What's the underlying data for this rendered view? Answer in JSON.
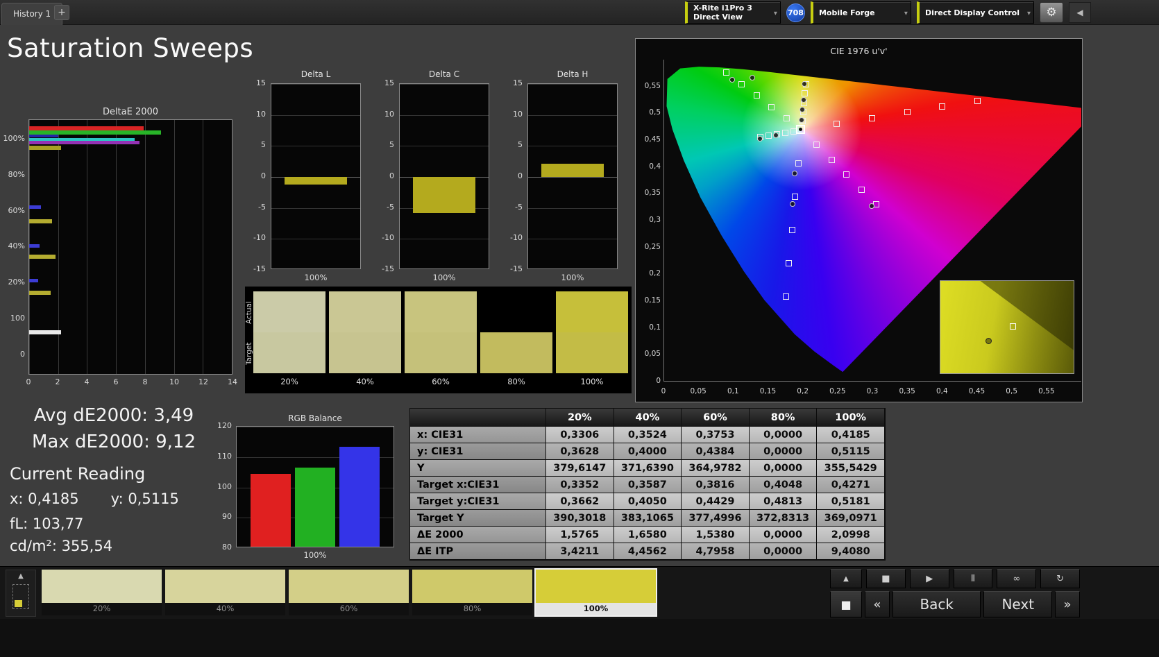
{
  "top_bar": {
    "history_tab": "History 1",
    "add_button": "+",
    "meter": {
      "line1": "X-Rite i1Pro 3",
      "line2": "Direct View"
    },
    "badge": "708",
    "source": "Mobile Forge",
    "display_control": "Direct Display Control",
    "gear_icon": "⚙",
    "collapse_icon": "◀",
    "chevron_icon": "▾"
  },
  "page_title": "Saturation Sweeps",
  "deltae_chart": {
    "title": "DeltaE 2000",
    "x_ticks": [
      "0",
      "2",
      "4",
      "6",
      "8",
      "10",
      "12",
      "14"
    ],
    "x_max": 14,
    "y_labels": [
      "100%",
      "80%",
      "60%",
      "40%",
      "20%",
      "100",
      "0"
    ],
    "bars": [
      {
        "color": "#d82424",
        "value": 7.9,
        "top": 0.024,
        "thickness": 6
      },
      {
        "color": "#28b428",
        "value": 9.12,
        "top": 0.041,
        "thickness": 6
      },
      {
        "color": "#2424a8",
        "value": 2.0,
        "top": 0.057,
        "thickness": 4
      },
      {
        "color": "#2cc4c4",
        "value": 7.3,
        "top": 0.07,
        "thickness": 5
      },
      {
        "color": "#9432b4",
        "value": 7.6,
        "top": 0.083,
        "thickness": 5
      },
      {
        "color": "#a8a024",
        "value": 2.2,
        "top": 0.1,
        "thickness": 6
      },
      {
        "color": "#3c3cd4",
        "value": 0.8,
        "top": 0.335,
        "thickness": 5
      },
      {
        "color": "#b4ac30",
        "value": 1.6,
        "top": 0.392,
        "thickness": 6
      },
      {
        "color": "#3c3cd4",
        "value": 0.7,
        "top": 0.488,
        "thickness": 5
      },
      {
        "color": "#b4ac30",
        "value": 1.8,
        "top": 0.531,
        "thickness": 6
      },
      {
        "color": "#3c3cd4",
        "value": 0.6,
        "top": 0.627,
        "thickness": 5
      },
      {
        "color": "#b4ac30",
        "value": 1.5,
        "top": 0.673,
        "thickness": 6
      },
      {
        "color": "#e8e8e8",
        "value": 2.2,
        "top": 0.828,
        "thickness": 6
      }
    ]
  },
  "delta_charts": {
    "y_ticks": [
      15,
      10,
      5,
      0,
      -5,
      -10,
      -15
    ],
    "x_label": "100%",
    "bar_color": "#b4aa1e",
    "items": [
      {
        "title": "Delta L",
        "from": 0,
        "to": -1.2
      },
      {
        "title": "Delta C",
        "from": 0,
        "to": -5.8
      },
      {
        "title": "Delta H",
        "from": 0,
        "to": 2.1
      }
    ]
  },
  "swatch_strip": {
    "row_labels": [
      "Actual",
      "Target"
    ],
    "cells": [
      {
        "label": "20%",
        "actual": "#cbcba8",
        "target": "#c8c8a0"
      },
      {
        "label": "40%",
        "actual": "#cac794",
        "target": "#c7c490"
      },
      {
        "label": "60%",
        "actual": "#c8c47e",
        "target": "#c5c17a"
      },
      {
        "label": "80%",
        "actual": "#000000",
        "target": "#c2bb5e"
      },
      {
        "label": "100%",
        "actual": "#c6bf3a",
        "target": "#c3bc46"
      }
    ]
  },
  "rgb_chart": {
    "title": "RGB Balance",
    "y_ticks": [
      120,
      110,
      100,
      90,
      80
    ],
    "y_min": 80,
    "y_max": 120,
    "x_label": "100%",
    "bars": [
      {
        "color": "#e02020",
        "value": 104
      },
      {
        "color": "#22b022",
        "value": 106
      },
      {
        "color": "#3434e8",
        "value": 113
      }
    ]
  },
  "readings": {
    "avg": "Avg dE2000: 3,49",
    "max": "Max dE2000: 9,12",
    "current_title": "Current Reading",
    "x": "x: 0,4185",
    "y": "y: 0,5115",
    "fl": "fL: 103,77",
    "cd": "cd/m²: 355,54"
  },
  "table": {
    "headers": [
      "20%",
      "40%",
      "60%",
      "80%",
      "100%"
    ],
    "rows": [
      {
        "label": "x: CIE31",
        "values": [
          "0,3306",
          "0,3524",
          "0,3753",
          "0,0000",
          "0,4185"
        ]
      },
      {
        "label": "y: CIE31",
        "values": [
          "0,3628",
          "0,4000",
          "0,4384",
          "0,0000",
          "0,5115"
        ]
      },
      {
        "label": "Y",
        "values": [
          "379,6147",
          "371,6390",
          "364,9782",
          "0,0000",
          "355,5429"
        ]
      },
      {
        "label": "Target x:CIE31",
        "values": [
          "0,3352",
          "0,3587",
          "0,3816",
          "0,4048",
          "0,4271"
        ]
      },
      {
        "label": "Target y:CIE31",
        "values": [
          "0,3662",
          "0,4050",
          "0,4429",
          "0,4813",
          "0,5181"
        ]
      },
      {
        "label": "Target Y",
        "values": [
          "390,3018",
          "383,1065",
          "377,4996",
          "372,8313",
          "369,0971"
        ]
      },
      {
        "label": "ΔE 2000",
        "values": [
          "1,5765",
          "1,6580",
          "1,5380",
          "0,0000",
          "2,0998"
        ]
      },
      {
        "label": "ΔE ITP",
        "values": [
          "3,4211",
          "4,4562",
          "4,7958",
          "0,0000",
          "9,4080"
        ]
      }
    ]
  },
  "cie": {
    "title": "CIE 1976 u'v'",
    "tick_values": [
      0,
      0.05,
      0.1,
      0.15,
      0.2,
      0.25,
      0.3,
      0.35,
      0.4,
      0.45,
      0.5,
      0.55
    ],
    "tick_labels": [
      "0",
      "0,05",
      "0,1",
      "0,15",
      "0,2",
      "0,25",
      "0,3",
      "0,35",
      "0,4",
      "0,45",
      "0,5",
      "0,55"
    ],
    "range": 0.6,
    "targets": [
      [
        0.2484,
        0.4792
      ],
      [
        0.299,
        0.4901
      ],
      [
        0.3495,
        0.5011
      ],
      [
        0.4001,
        0.512
      ],
      [
        0.4507,
        0.5229
      ],
      [
        0.1762,
        0.4896
      ],
      [
        0.1547,
        0.511
      ],
      [
        0.1331,
        0.5323
      ],
      [
        0.1116,
        0.5537
      ],
      [
        0.09,
        0.575
      ],
      [
        0.1933,
        0.4062
      ],
      [
        0.1888,
        0.3441
      ],
      [
        0.1844,
        0.2821
      ],
      [
        0.1799,
        0.22
      ],
      [
        0.1754,
        0.1579
      ],
      [
        0.1859,
        0.4657
      ],
      [
        0.174,
        0.4631
      ],
      [
        0.1621,
        0.4606
      ],
      [
        0.1502,
        0.458
      ],
      [
        0.1383,
        0.4554
      ],
      [
        0.2192,
        0.4406
      ],
      [
        0.2407,
        0.4129
      ],
      [
        0.2621,
        0.3852
      ],
      [
        0.2836,
        0.3575
      ],
      [
        0.305,
        0.3298
      ],
      [
        0.199,
        0.4852
      ],
      [
        0.2002,
        0.5021
      ],
      [
        0.2015,
        0.5191
      ],
      [
        0.2027,
        0.536
      ],
      [
        0.2039,
        0.5529
      ]
    ],
    "dots": [
      [
        0.1976,
        0.4879
      ],
      [
        0.1987,
        0.5074
      ],
      [
        0.1999,
        0.5253
      ],
      [
        0.2017,
        0.5546
      ],
      [
        0.127,
        0.566
      ],
      [
        0.098,
        0.563
      ],
      [
        0.138,
        0.452
      ],
      [
        0.187,
        0.388
      ],
      [
        0.184,
        0.331
      ],
      [
        0.298,
        0.327
      ],
      [
        0.16,
        0.459
      ]
    ],
    "current": [
      0.196,
      0.469
    ],
    "inset": {
      "dot": [
        0.34,
        0.62
      ],
      "square": [
        0.52,
        0.46
      ]
    }
  },
  "bottom_bar": {
    "patches": [
      {
        "label": "20%",
        "color": "#d9d9b0",
        "selected": false
      },
      {
        "label": "40%",
        "color": "#d7d49c",
        "selected": false
      },
      {
        "label": "60%",
        "color": "#d3cf88",
        "selected": false
      },
      {
        "label": "80%",
        "color": "#cfc96a",
        "selected": false
      },
      {
        "label": "100%",
        "color": "#d6cd38",
        "selected": true
      }
    ],
    "icons": {
      "up": "▲",
      "stop": "■",
      "play": "▶",
      "pause": "Ⅱ",
      "loop": "∞",
      "refresh": "↻",
      "big_stop": "■",
      "back_chev": "«",
      "next_chev": "»"
    },
    "back": "Back",
    "next": "Next"
  }
}
